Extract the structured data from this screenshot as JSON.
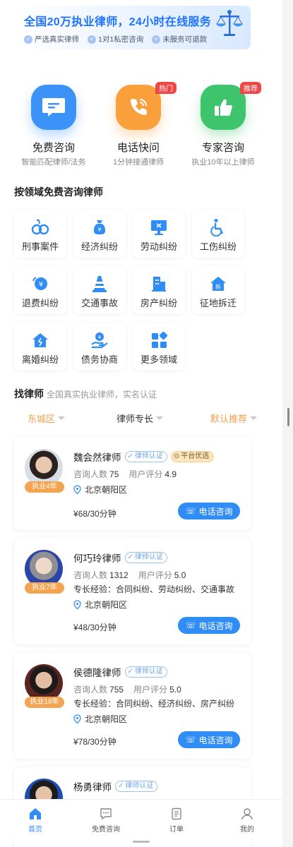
{
  "banner": {
    "headline": "全国20万执业律师，24小时在线服务",
    "features": [
      "严选真实律师",
      "1对1私密咨询",
      "未服务可退款"
    ]
  },
  "services": [
    {
      "name": "免费咨询",
      "sub": "智能匹配律师/法务",
      "icon": "chat-icon",
      "color": "#3d92f8",
      "tag": ""
    },
    {
      "name": "电话快问",
      "sub": "1分钟接通律师",
      "icon": "phone-icon",
      "color": "#f9a03c",
      "tag": "热门"
    },
    {
      "name": "专家咨询",
      "sub": "执业10年以上律师",
      "icon": "thumbs-up-icon",
      "color": "#3ec46d",
      "tag": "推荐"
    }
  ],
  "domains_title": "按领域免费咨询律师",
  "domains": [
    {
      "label": "刑事案件",
      "icon": "handcuffs-icon"
    },
    {
      "label": "经济纠纷",
      "icon": "money-bag-icon"
    },
    {
      "label": "劳动纠纷",
      "icon": "monitor-icon"
    },
    {
      "label": "工伤纠纷",
      "icon": "wheelchair-icon"
    },
    {
      "label": "退费纠纷",
      "icon": "refund-icon"
    },
    {
      "label": "交通事故",
      "icon": "traffic-cone-icon"
    },
    {
      "label": "房产纠纷",
      "icon": "building-icon"
    },
    {
      "label": "征地拆迁",
      "icon": "demolition-house-icon"
    },
    {
      "label": "离婚纠纷",
      "icon": "broken-home-icon"
    },
    {
      "label": "债务协商",
      "icon": "debt-hand-icon"
    },
    {
      "label": "更多领域",
      "icon": "grid-more-icon"
    }
  ],
  "find_lawyer": {
    "title": "找律师",
    "subtitle": "全国真实执业律师，实名认证"
  },
  "filters": {
    "district": "东城区",
    "specialty": "律师专长",
    "sort": "默认推荐"
  },
  "labels": {
    "cert": "律师认证",
    "pick": "平台优选",
    "consults": "咨询人数",
    "rating": "用户评分",
    "call": "电话咨询"
  },
  "lawyers": [
    {
      "name": "魏会然律师",
      "years": "执业4年",
      "consults": "75",
      "rating": "4.9",
      "specialty": "",
      "location": "北京朝阳区",
      "price": "¥68/30分钟",
      "pick": true
    },
    {
      "name": "何巧玲律师",
      "years": "执业7年",
      "consults": "1312",
      "rating": "5.0",
      "specialty": "专长经验：合同纠纷、劳动纠纷、交通事故",
      "location": "北京朝阳区",
      "price": "¥48/30分钟",
      "pick": false
    },
    {
      "name": "侯德隆律师",
      "years": "执业18年",
      "consults": "755",
      "rating": "5.0",
      "specialty": "专长经验：合同纠纷、经济纠纷、房产纠纷",
      "location": "北京朝阳区",
      "price": "¥78/30分钟",
      "pick": false
    },
    {
      "name": "杨勇律师",
      "years": "",
      "consults": "",
      "rating": "",
      "specialty": "",
      "location": "",
      "price": "",
      "pick": false
    }
  ],
  "tabbar": [
    {
      "label": "首页",
      "icon": "home-icon",
      "active": true
    },
    {
      "label": "免费咨询",
      "icon": "chat-icon",
      "active": false
    },
    {
      "label": "订单",
      "icon": "order-icon",
      "active": false
    },
    {
      "label": "我的",
      "icon": "profile-icon",
      "active": false
    }
  ],
  "colors": {
    "primary": "#2f8df5",
    "orange": "#f4a450",
    "filter_orange": "#f0a050"
  }
}
